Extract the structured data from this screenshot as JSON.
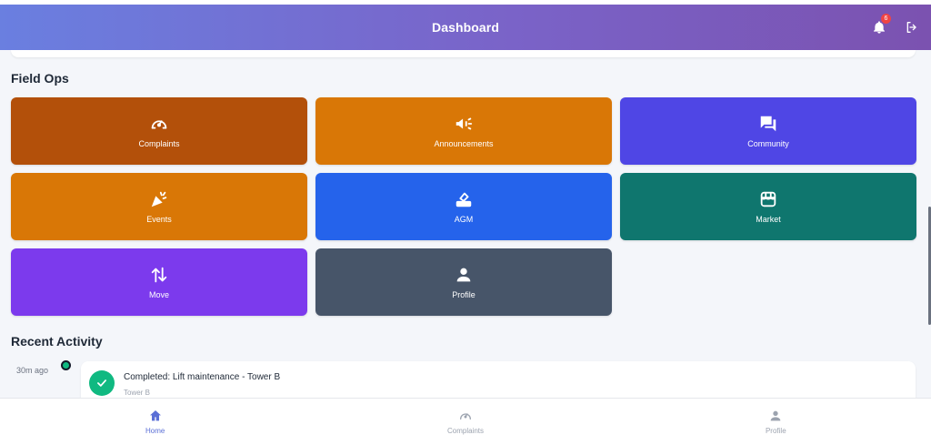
{
  "header": {
    "title": "Dashboard",
    "notification_count": "6",
    "icons": {
      "notifications": "bell-icon",
      "logout": "logout-icon"
    },
    "gradient": [
      "#6a7fe0",
      "#7b52b0"
    ]
  },
  "field_ops": {
    "title": "Field Ops",
    "tiles": [
      {
        "label": "Complaints",
        "icon": "gauge-icon",
        "color": "#b3500a"
      },
      {
        "label": "Announcements",
        "icon": "megaphone-icon",
        "color": "#d97706"
      },
      {
        "label": "Community",
        "icon": "chat-icon",
        "color": "#4f46e5"
      },
      {
        "label": "Events",
        "icon": "party-icon",
        "color": "#d97706"
      },
      {
        "label": "AGM",
        "icon": "ballot-icon",
        "color": "#2563eb"
      },
      {
        "label": "Market",
        "icon": "store-icon",
        "color": "#0f766e"
      },
      {
        "label": "Move",
        "icon": "swap-vertical-icon",
        "color": "#7c3aed"
      },
      {
        "label": "Profile",
        "icon": "person-icon",
        "color": "#475569"
      }
    ]
  },
  "recent_activity": {
    "title": "Recent Activity",
    "items": [
      {
        "time": "30m ago",
        "title": "Completed: Lift maintenance - Tower B",
        "subtitle": "Tower B",
        "status_color": "#10b981"
      }
    ]
  },
  "bottom_nav": {
    "items": [
      {
        "label": "Home",
        "icon": "home-icon",
        "active": true
      },
      {
        "label": "Complaints",
        "icon": "gauge-icon",
        "active": false
      },
      {
        "label": "Profile",
        "icon": "person-icon",
        "active": false
      }
    ],
    "active_color": "#5b6fd6"
  }
}
